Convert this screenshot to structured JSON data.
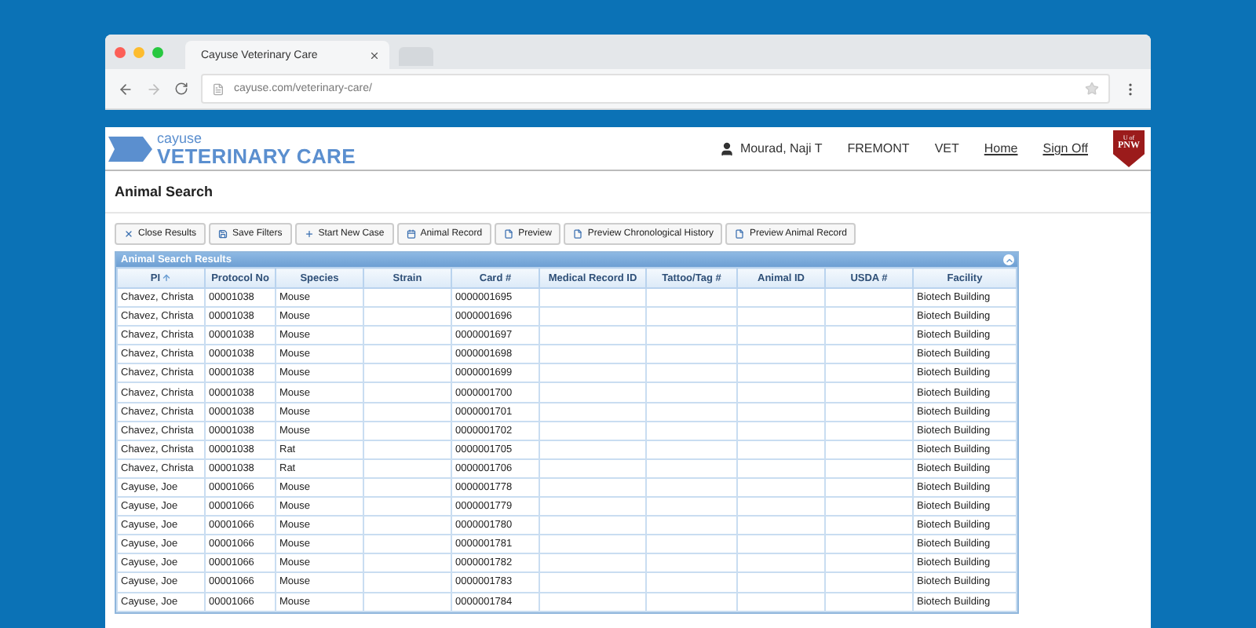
{
  "browser": {
    "tab_title": "Cayuse Veterinary Care",
    "url": "cayuse.com/veterinary-care/"
  },
  "header": {
    "brand_top": "cayuse",
    "brand_main": "VETERINARY CARE",
    "user": "Mourad, Naji T",
    "nav": [
      {
        "label": "FREMONT",
        "kind": "text"
      },
      {
        "label": "VET",
        "kind": "text"
      },
      {
        "label": "Home",
        "kind": "link"
      },
      {
        "label": "Sign Off",
        "kind": "link"
      }
    ],
    "badge_top": "U of",
    "badge_main": "PNW"
  },
  "page_title": "Animal Search",
  "toolbar": [
    {
      "label": "Close Results",
      "kind": "close"
    },
    {
      "label": "Save Filters",
      "kind": "save"
    },
    {
      "label": "Start New Case",
      "kind": "add"
    },
    {
      "label": "Animal Record",
      "kind": "calendar"
    },
    {
      "label": "Preview",
      "kind": "document"
    },
    {
      "label": "Preview Chronological History",
      "kind": "document"
    },
    {
      "label": "Preview Animal Record",
      "kind": "document"
    }
  ],
  "table": {
    "title": "Animal Search Results",
    "columns": [
      {
        "label": "PI",
        "sorted": true
      },
      {
        "label": "Protocol No",
        "sorted": false
      },
      {
        "label": "Species",
        "sorted": false
      },
      {
        "label": "Strain",
        "sorted": false
      },
      {
        "label": "Card #",
        "sorted": false
      },
      {
        "label": "Medical Record ID",
        "sorted": false
      },
      {
        "label": "Tattoo/Tag #",
        "sorted": false
      },
      {
        "label": "Animal ID",
        "sorted": false
      },
      {
        "label": "USDA #",
        "sorted": false
      },
      {
        "label": "Facility",
        "sorted": false
      }
    ],
    "rows": [
      [
        "Chavez, Christa",
        "00001038",
        "Mouse",
        null,
        "0000001695",
        null,
        null,
        null,
        null,
        "Biotech Building"
      ],
      [
        "Chavez, Christa",
        "00001038",
        "Mouse",
        null,
        "0000001696",
        null,
        null,
        null,
        null,
        "Biotech Building"
      ],
      [
        "Chavez, Christa",
        "00001038",
        "Mouse",
        null,
        "0000001697",
        null,
        null,
        null,
        null,
        "Biotech Building"
      ],
      [
        "Chavez, Christa",
        "00001038",
        "Mouse",
        null,
        "0000001698",
        null,
        null,
        null,
        null,
        "Biotech Building"
      ],
      [
        "Chavez, Christa",
        "00001038",
        "Mouse",
        null,
        "0000001699",
        null,
        null,
        null,
        null,
        "Biotech Building"
      ],
      [
        "Chavez, Christa",
        "00001038",
        "Mouse",
        null,
        "0000001700",
        null,
        null,
        null,
        null,
        "Biotech Building"
      ],
      [
        "Chavez, Christa",
        "00001038",
        "Mouse",
        null,
        "0000001701",
        null,
        null,
        null,
        null,
        "Biotech Building"
      ],
      [
        "Chavez, Christa",
        "00001038",
        "Mouse",
        null,
        "0000001702",
        null,
        null,
        null,
        null,
        "Biotech Building"
      ],
      [
        "Chavez, Christa",
        "00001038",
        "Rat",
        null,
        "0000001705",
        null,
        null,
        null,
        null,
        "Biotech Building"
      ],
      [
        "Chavez, Christa",
        "00001038",
        "Rat",
        null,
        "0000001706",
        null,
        null,
        null,
        null,
        "Biotech Building"
      ],
      [
        "Cayuse, Joe",
        "00001066",
        "Mouse",
        null,
        "0000001778",
        null,
        null,
        null,
        null,
        "Biotech Building"
      ],
      [
        "Cayuse, Joe",
        "00001066",
        "Mouse",
        null,
        "0000001779",
        null,
        null,
        null,
        null,
        "Biotech Building"
      ],
      [
        "Cayuse, Joe",
        "00001066",
        "Mouse",
        null,
        "0000001780",
        null,
        null,
        null,
        null,
        "Biotech Building"
      ],
      [
        "Cayuse, Joe",
        "00001066",
        "Mouse",
        null,
        "0000001781",
        null,
        null,
        null,
        null,
        "Biotech Building"
      ],
      [
        "Cayuse, Joe",
        "00001066",
        "Mouse",
        null,
        "0000001782",
        null,
        null,
        null,
        null,
        "Biotech Building"
      ],
      [
        "Cayuse, Joe",
        "00001066",
        "Mouse",
        null,
        "0000001783",
        null,
        null,
        null,
        null,
        "Biotech Building"
      ],
      [
        "Cayuse, Joe",
        "00001066",
        "Mouse",
        null,
        "0000001784",
        null,
        null,
        null,
        null,
        "Biotech Building"
      ]
    ]
  }
}
